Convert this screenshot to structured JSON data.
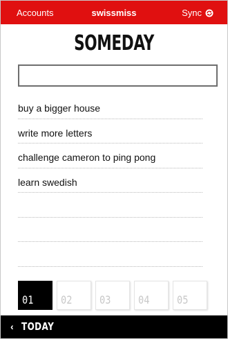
{
  "topbar": {
    "accounts_label": "Accounts",
    "brand": "swissmiss",
    "sync_label": "Sync",
    "sync_icon": "sync-icon",
    "background": "#e01010"
  },
  "page_title": "SOMEDAY",
  "new_item": {
    "value": "",
    "placeholder": ""
  },
  "list": {
    "items": [
      "buy a bigger house",
      "write more letters",
      "challenge cameron to ping pong",
      "learn swedish",
      "",
      "",
      ""
    ]
  },
  "pages": {
    "tabs": [
      "01",
      "02",
      "03",
      "04",
      "05"
    ],
    "active": "01"
  },
  "bottombar": {
    "chevron_icon": "chevron-left-icon",
    "label": "TODAY",
    "background": "#000000"
  }
}
